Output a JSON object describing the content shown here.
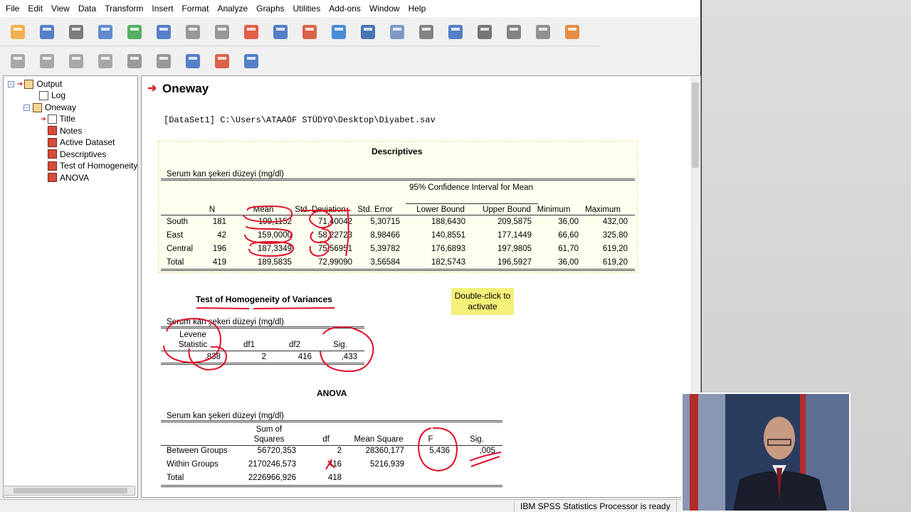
{
  "menu": [
    "File",
    "Edit",
    "View",
    "Data",
    "Transform",
    "Insert",
    "Format",
    "Analyze",
    "Graphs",
    "Utilities",
    "Add-ons",
    "Window",
    "Help"
  ],
  "toolbar1_icons": [
    "open-folder-icon",
    "save-icon",
    "print-icon",
    "print-preview-icon",
    "export-icon",
    "recall-dialog-icon",
    "undo-icon",
    "redo-icon",
    "goto-case-icon",
    "goto-variable-icon",
    "insert-cases-icon",
    "variables-icon",
    "insert-output-icon",
    "select-cases-icon",
    "weight-cases-icon",
    "value-labels-icon",
    "promote-icon",
    "demote-icon",
    "designate-window-icon",
    "script-icon"
  ],
  "toolbar2_icons": [
    "back-arrow-icon",
    "forward-arrow-icon",
    "expand-plus-icon",
    "collapse-minus-icon",
    "show-icon",
    "hide-icon",
    "insert-heading-icon",
    "insert-title-icon",
    "insert-text-icon"
  ],
  "outline": {
    "root": "Output",
    "log": "Log",
    "oneway": "Oneway",
    "children": [
      "Title",
      "Notes",
      "Active Dataset",
      "Descriptives",
      "Test of Homogeneity of Variances",
      "ANOVA"
    ]
  },
  "output": {
    "heading": "Oneway",
    "dataset_line": "[DataSet1] C:\\Users\\ATAAÖF STÜDYO\\Desktop\\Diyabet.sav",
    "descriptives": {
      "title": "Descriptives",
      "subtitle": "Serum kan şekeri düzeyi (mg/dl)",
      "ci_header": "95% Confidence Interval for Mean",
      "columns": [
        "N",
        "Mean",
        "Std. Deviation",
        "Std. Error",
        "Lower Bound",
        "Upper Bound",
        "Minimum",
        "Maximum"
      ],
      "rows": [
        {
          "label": "South",
          "cells": [
            "181",
            "199,1152",
            "71,40042",
            "5,30715",
            "188,6430",
            "209,5875",
            "36,00",
            "432,00"
          ]
        },
        {
          "label": "East",
          "cells": [
            "42",
            "159,0000",
            "58,22723",
            "8,98466",
            "140,8551",
            "177,1449",
            "66,60",
            "325,80"
          ]
        },
        {
          "label": "Central",
          "cells": [
            "196",
            "187,3349",
            "75,56951",
            "5,39782",
            "176,6893",
            "197,9805",
            "61,70",
            "619,20"
          ]
        },
        {
          "label": "Total",
          "cells": [
            "419",
            "189,5835",
            "72,99090",
            "3,56584",
            "182,5743",
            "196,5927",
            "36,00",
            "619,20"
          ]
        }
      ]
    },
    "homogeneity": {
      "title": "Test of Homogeneity of Variances",
      "subtitle": "Serum kan şekeri düzeyi (mg/dl)",
      "columns": [
        "Levene Statistic",
        "df1",
        "df2",
        "Sig."
      ],
      "values": [
        ",838",
        "2",
        "416",
        ",433"
      ]
    },
    "tooltip": "Double-click to activate",
    "anova": {
      "title": "ANOVA",
      "subtitle": "Serum kan şekeri düzeyi (mg/dl)",
      "columns": [
        "Sum of Squares",
        "df",
        "Mean Square",
        "F",
        "Sig."
      ],
      "rows": [
        {
          "label": "Between Groups",
          "cells": [
            "56720,353",
            "2",
            "28360,177",
            "5,436",
            ",005"
          ]
        },
        {
          "label": "Within Groups",
          "cells": [
            "2170246,573",
            "416",
            "5216,939",
            "",
            ""
          ]
        },
        {
          "label": "Total",
          "cells": [
            "2226966,926",
            "418",
            "",
            "",
            ""
          ]
        }
      ]
    }
  },
  "status": "IBM SPSS Statistics Processor is ready",
  "colors": {
    "annotation": "#e0102a",
    "heading_arrow": "#d9262a",
    "tooltip": "#f5f07a"
  }
}
